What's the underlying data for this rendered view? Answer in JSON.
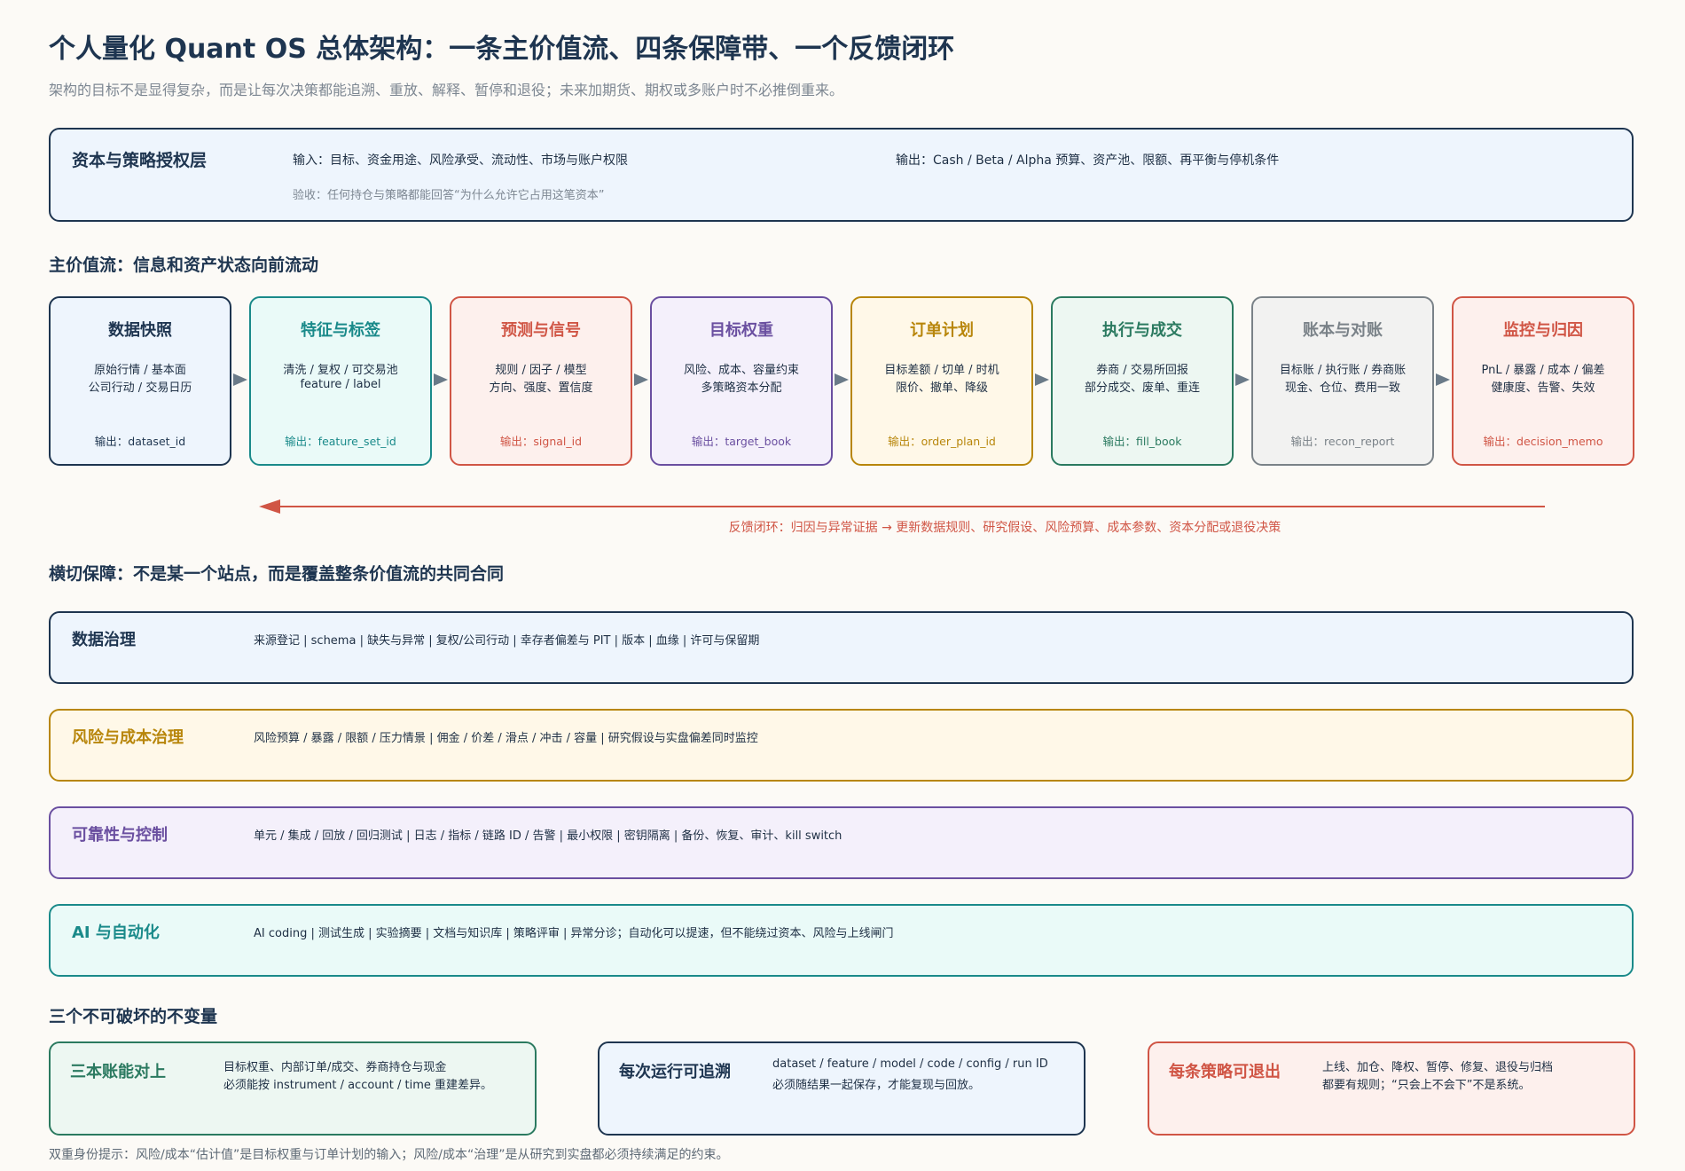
{
  "header": {
    "title": "个人量化 Quant OS 总体架构：一条主价值流、四条保障带、一个反馈闭环",
    "subtitle": "架构的目标不是显得复杂，而是让每次决策都能追溯、重放、解释、暂停和退役；未来加期货、期权或多账户时不必推倒重来。"
  },
  "authorization": {
    "name": "资本与策略授权层",
    "input": "输入：目标、资金用途、风险承受、流动性、市场与账户权限",
    "output": "输出：Cash / Beta / Alpha 预算、资产池、限额、再平衡与停机条件",
    "acceptance": "验收：任何持仓与策略都能回答“为什么允许它占用这笔资本”"
  },
  "mainflow": {
    "section_title": "主价值流：信息和资产状态向前流动",
    "stages": [
      {
        "title": "数据快照",
        "d1": "原始行情 / 基本面",
        "d2": "公司行动 / 交易日历",
        "output": "输出：dataset_id",
        "color": "#1e3550",
        "fill": "#eef5fd"
      },
      {
        "title": "特征与标签",
        "d1": "清洗 / 复权 / 可交易池",
        "d2": "feature / label",
        "output": "输出：feature_set_id",
        "color": "#1a8a8a",
        "fill": "#eafaf8"
      },
      {
        "title": "预测与信号",
        "d1": "规则 / 因子 / 模型",
        "d2": "方向、强度、置信度",
        "output": "输出：signal_id",
        "color": "#d05545",
        "fill": "#fdf0ed"
      },
      {
        "title": "目标权重",
        "d1": "风险、成本、容量约束",
        "d2": "多策略资本分配",
        "output": "输出：target_book",
        "color": "#6a4fa0",
        "fill": "#f4f0fb"
      },
      {
        "title": "订单计划",
        "d1": "目标差额 / 切单 / 时机",
        "d2": "限价、撤单、降级",
        "output": "输出：order_plan_id",
        "color": "#b8860b",
        "fill": "#fff8e8"
      },
      {
        "title": "执行与成交",
        "d1": "券商 / 交易所回报",
        "d2": "部分成交、废单、重连",
        "output": "输出：fill_book",
        "color": "#2b7a60",
        "fill": "#edf7f2"
      },
      {
        "title": "账本与对账",
        "d1": "目标账 / 执行账 / 券商账",
        "d2": "现金、仓位、费用一致",
        "output": "输出：recon_report",
        "color": "#7a8288",
        "fill": "#f2f2f1"
      },
      {
        "title": "监控与归因",
        "d1": "PnL / 暴露 / 成本 / 偏差",
        "d2": "健康度、告警、失效",
        "output": "输出：decision_memo",
        "color": "#d05545",
        "fill": "#fdf0ed"
      }
    ]
  },
  "feedback": {
    "label": "反馈闭环：归因与异常证据 → 更新数据规则、研究假设、风险预算、成本参数、资本分配或退役决策",
    "color": "#d05545"
  },
  "guarantees": {
    "section_title": "横切保障：不是某一个站点，而是覆盖整条价值流的共同合同",
    "bands": [
      {
        "name": "数据治理",
        "desc": "来源登记 | schema | 缺失与异常 | 复权/公司行动 | 幸存者偏差与 PIT | 版本 | 血缘 | 许可与保留期",
        "color": "#1e3550",
        "fill": "#eef5fd"
      },
      {
        "name": "风险与成本治理",
        "desc": "风险预算 / 暴露 / 限额 / 压力情景 | 佣金 / 价差 / 滑点 / 冲击 / 容量 | 研究假设与实盘偏差同时监控",
        "color": "#b8860b",
        "fill": "#fff8e8"
      },
      {
        "name": "可靠性与控制",
        "desc": "单元 / 集成 / 回放 / 回归测试 | 日志 / 指标 / 链路 ID / 告警 | 最小权限 | 密钥隔离 | 备份、恢复、审计、kill switch",
        "color": "#6a4fa0",
        "fill": "#f4f0fb"
      },
      {
        "name": "AI 与自动化",
        "desc": "AI coding | 测试生成 | 实验摘要 | 文档与知识库 | 策略评审 | 异常分诊；自动化可以提速，但不能绕过资本、风险与上线闸门",
        "color": "#1a8a8a",
        "fill": "#eafaf8"
      }
    ]
  },
  "invariants": {
    "section_title": "三个不可破坏的不变量",
    "items": [
      {
        "name": "三本账能对上",
        "l1": "目标权重、内部订单/成交、券商持仓与现金",
        "l2": "必须能按 instrument / account / time 重建差异。",
        "color": "#2b7a60",
        "fill": "#edf7f2"
      },
      {
        "name": "每次运行可追溯",
        "l1": "dataset / feature / model / code / config / run ID",
        "l2": "必须随结果一起保存，才能复现与回放。",
        "color": "#1e3550",
        "fill": "#eef5fd"
      },
      {
        "name": "每条策略可退出",
        "l1": "上线、加仓、降权、暂停、修复、退役与归档",
        "l2": "都要有规则；“只会上不会下”不是系统。",
        "color": "#d05545",
        "fill": "#fdf0ed"
      }
    ]
  },
  "footnote": "双重身份提示：风险/成本“估计值”是目标权重与订单计划的输入；风险/成本“治理”是从研究到实盘都必须持续满足的约束。"
}
